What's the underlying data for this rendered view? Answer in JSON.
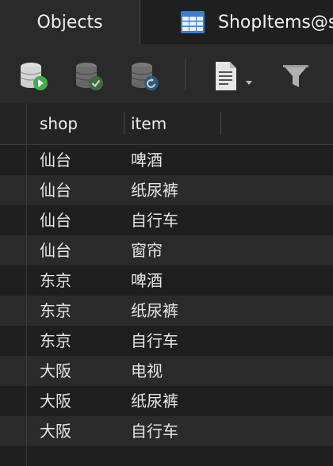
{
  "tabs": {
    "objects_label": "Objects",
    "shop_label": "ShopItems@s"
  },
  "toolbar": {
    "buttons": [
      "begin-transaction-icon",
      "commit-icon",
      "rollback-icon",
      "text-view-icon",
      "filter-icon"
    ]
  },
  "table": {
    "columns": [
      "shop",
      "item"
    ],
    "rows": [
      [
        "仙台",
        "啤酒"
      ],
      [
        "仙台",
        "纸尿裤"
      ],
      [
        "仙台",
        "自行车"
      ],
      [
        "仙台",
        "窗帘"
      ],
      [
        "东京",
        "啤酒"
      ],
      [
        "东京",
        "纸尿裤"
      ],
      [
        "东京",
        "自行车"
      ],
      [
        "大阪",
        "电视"
      ],
      [
        "大阪",
        "纸尿裤"
      ],
      [
        "大阪",
        "自行车"
      ]
    ]
  },
  "colors": {
    "accent_green": "#4caf50",
    "accent_blue": "#2f7fc1"
  }
}
